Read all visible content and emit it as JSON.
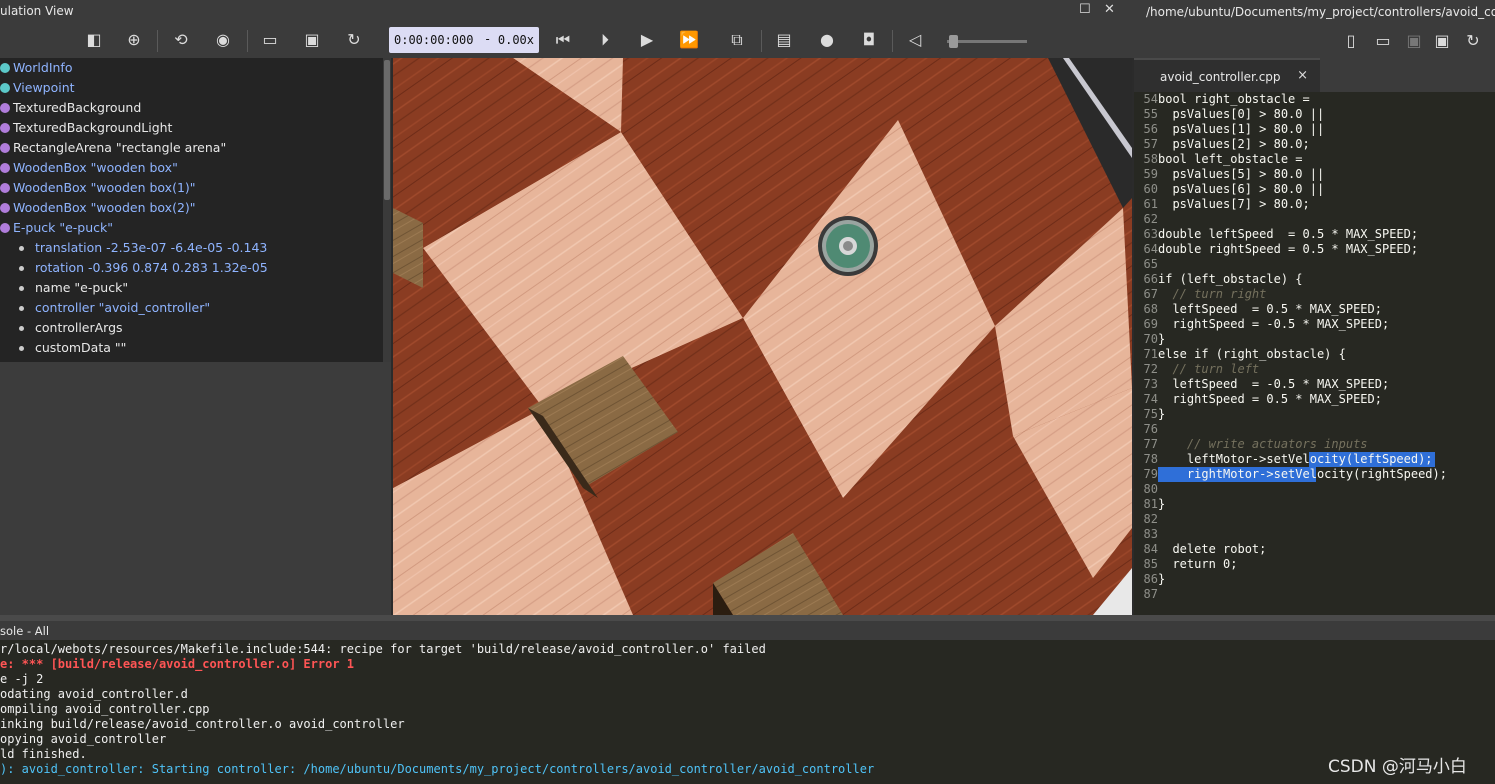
{
  "window": {
    "title": "ulation View",
    "maximize_icon": "maximize-icon",
    "close_icon": "close-icon"
  },
  "toolbar": {
    "time": "0:00:00:000",
    "time_sep": "-",
    "speed": "0.00x",
    "icons": [
      "toggle-panel-icon",
      "add-node-icon",
      "reload-world-icon",
      "view-icon",
      "open-icon",
      "save-icon",
      "revert-icon",
      "step-back-icon",
      "step-icon",
      "play-icon",
      "fast-forward-icon",
      "fullscreen-icon",
      "record-movie-icon",
      "record-icon",
      "screenshot-icon",
      "mute-icon"
    ]
  },
  "scene_tree": {
    "nodes": [
      {
        "label": "WorldInfo",
        "color": "#5cc9c9",
        "kind": "field"
      },
      {
        "label": "Viewpoint",
        "color": "#5cc9c9",
        "kind": "field"
      },
      {
        "label": "TexturedBackground",
        "color": "#b07ddb",
        "kind": "node"
      },
      {
        "label": "TexturedBackgroundLight",
        "color": "#b07ddb",
        "kind": "node"
      },
      {
        "label": "RectangleArena \"rectangle arena\"",
        "color": "#b07ddb",
        "kind": "node"
      },
      {
        "label": "WoodenBox \"wooden box\"",
        "color": "#b07ddb",
        "kind": "field"
      },
      {
        "label": "WoodenBox \"wooden box(1)\"",
        "color": "#b07ddb",
        "kind": "field"
      },
      {
        "label": "WoodenBox \"wooden box(2)\"",
        "color": "#b07ddb",
        "kind": "field"
      },
      {
        "label": "E-puck \"e-puck\"",
        "color": "#b07ddb",
        "kind": "field"
      }
    ],
    "children": [
      {
        "label": "translation -2.53e-07 -6.4e-05 -0.143",
        "kind": "field"
      },
      {
        "label": "rotation -0.396 0.874 0.283 1.32e-05",
        "kind": "field"
      },
      {
        "label": "name \"e-puck\"",
        "kind": "node"
      },
      {
        "label": "controller \"avoid_controller\"",
        "kind": "field"
      },
      {
        "label": "controllerArgs",
        "kind": "node"
      },
      {
        "label": "customData \"\"",
        "kind": "node"
      }
    ]
  },
  "editor": {
    "path": "/home/ubuntu/Documents/my_project/controllers/avoid_controller/av",
    "tab_name": "avoid_controller.cpp",
    "tab_close": "×",
    "icons": [
      "new-file-icon",
      "open-file-icon",
      "save-icon",
      "save-all-icon",
      "revert-file-icon"
    ],
    "lines": [
      {
        "n": "54",
        "text": "bool right_obstacle ="
      },
      {
        "n": "55",
        "text": "  psValues[0] > 80.0 ||"
      },
      {
        "n": "56",
        "text": "  psValues[1] > 80.0 ||"
      },
      {
        "n": "57",
        "text": "  psValues[2] > 80.0;"
      },
      {
        "n": "58",
        "text": "bool left_obstacle ="
      },
      {
        "n": "59",
        "text": "  psValues[5] > 80.0 ||"
      },
      {
        "n": "60",
        "text": "  psValues[6] > 80.0 ||"
      },
      {
        "n": "61",
        "text": "  psValues[7] > 80.0;"
      },
      {
        "n": "62",
        "text": ""
      },
      {
        "n": "63",
        "text": "double leftSpeed  = 0.5 * MAX_SPEED;"
      },
      {
        "n": "64",
        "text": "double rightSpeed = 0.5 * MAX_SPEED;"
      },
      {
        "n": "65",
        "text": ""
      },
      {
        "n": "66",
        "text": "if (left_obstacle) {"
      },
      {
        "n": "67",
        "text": "  // turn right"
      },
      {
        "n": "68",
        "text": "  leftSpeed  = 0.5 * MAX_SPEED;"
      },
      {
        "n": "69",
        "text": "  rightSpeed = -0.5 * MAX_SPEED;"
      },
      {
        "n": "70",
        "text": "}"
      },
      {
        "n": "71",
        "text": "else if (right_obstacle) {"
      },
      {
        "n": "72",
        "text": "  // turn left"
      },
      {
        "n": "73",
        "text": "  leftSpeed  = -0.5 * MAX_SPEED;"
      },
      {
        "n": "74",
        "text": "  rightSpeed = 0.5 * MAX_SPEED;"
      },
      {
        "n": "75",
        "text": "}"
      },
      {
        "n": "76",
        "text": ""
      },
      {
        "n": "77",
        "text": "    // write actuators inputs"
      },
      {
        "n": "78",
        "text": "    leftMotor->setVelocity(leftSpeed);"
      },
      {
        "n": "79",
        "text": "    rightMotor->setVelocity(rightSpeed);"
      },
      {
        "n": "80",
        "text": ""
      },
      {
        "n": "81",
        "text": "}"
      },
      {
        "n": "82",
        "text": ""
      },
      {
        "n": "83",
        "text": ""
      },
      {
        "n": "84",
        "text": "  delete robot;"
      },
      {
        "n": "85",
        "text": "  return 0;"
      },
      {
        "n": "86",
        "text": "}"
      },
      {
        "n": "87",
        "text": ""
      }
    ]
  },
  "console": {
    "title": "sole - All",
    "lines": [
      {
        "text": "r/local/webots/resources/Makefile.include:544: recipe for target 'build/release/avoid_controller.o' failed",
        "color": "#f0f0f0"
      },
      {
        "text": "e: *** [build/release/avoid_controller.o] Error 1",
        "color": "#ff5555"
      },
      {
        "text": "e -j 2",
        "color": "#f0f0f0"
      },
      {
        "text": "odating avoid_controller.d",
        "color": "#f0f0f0"
      },
      {
        "text": "ompiling avoid_controller.cpp",
        "color": "#f0f0f0"
      },
      {
        "text": "inking build/release/avoid_controller.o avoid_controller",
        "color": "#f0f0f0"
      },
      {
        "text": "opying avoid_controller",
        "color": "#f0f0f0"
      },
      {
        "text": "ld finished.",
        "color": "#f0f0f0"
      },
      {
        "text": "): avoid_controller: Starting controller: /home/ubuntu/Documents/my_project/controllers/avoid_controller/avoid_controller",
        "color": "#4fc3f7"
      }
    ]
  },
  "watermark": "CSDN @河马小白"
}
